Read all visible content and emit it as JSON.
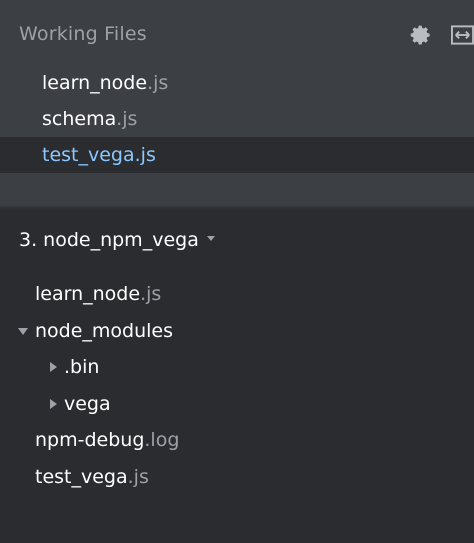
{
  "working_files": {
    "title": "Working Files",
    "settings_icon": "gear-icon",
    "split_icon": "split-view-icon",
    "items": [
      {
        "name": "learn_node",
        "ext": ".js",
        "selected": false
      },
      {
        "name": "schema",
        "ext": ".js",
        "selected": false
      },
      {
        "name": "test_vega",
        "ext": ".js",
        "selected": true
      }
    ]
  },
  "project": {
    "title": "3. node_npm_vega",
    "dropdown_icon": "caret-down-icon",
    "tree": [
      {
        "name": "learn_node",
        "ext": ".js",
        "type": "file",
        "level": 0
      },
      {
        "name": "node_modules",
        "ext": "",
        "type": "folder",
        "expanded": true,
        "level": 0
      },
      {
        "name": ".bin",
        "ext": "",
        "type": "folder",
        "expanded": false,
        "level": 1
      },
      {
        "name": "vega",
        "ext": "",
        "type": "folder",
        "expanded": false,
        "level": 1
      },
      {
        "name": "npm-debug",
        "ext": ".log",
        "type": "file",
        "level": 0
      },
      {
        "name": "test_vega",
        "ext": ".js",
        "type": "file",
        "level": 0
      }
    ]
  },
  "colors": {
    "working_bg": "#3c3f43",
    "project_bg": "#2a2c30",
    "selected_text": "#8cc8ff",
    "muted_text": "#9ea1a6"
  }
}
